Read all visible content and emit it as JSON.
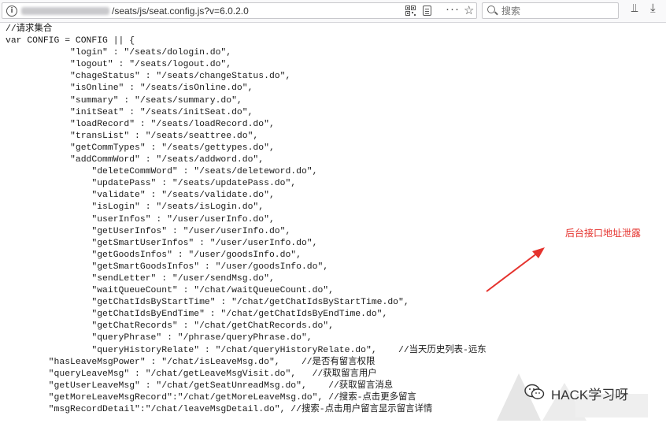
{
  "browser": {
    "url_path": "/seats/js/seat.config.js?v=6.0.2.0",
    "search_placeholder": "搜索",
    "more_glyph": "···"
  },
  "code_lines": [
    "//请求集合",
    "var CONFIG = CONFIG || {",
    "            \"login\" : \"/seats/dologin.do\",",
    "            \"logout\" : \"/seats/logout.do\",",
    "            \"chageStatus\" : \"/seats/changeStatus.do\",",
    "            \"isOnline\" : \"/seats/isOnline.do\",",
    "            \"summary\" : \"/seats/summary.do\",",
    "            \"initSeat\" : \"/seats/initSeat.do\",",
    "            \"loadRecord\" : \"/seats/loadRecord.do\",",
    "            \"transList\" : \"/seats/seattree.do\",",
    "            \"getCommTypes\" : \"/seats/gettypes.do\",",
    "            \"addCommWord\" : \"/seats/addword.do\",",
    "                \"deleteCommWord\" : \"/seats/deleteword.do\",",
    "                \"updatePass\" : \"/seats/updatePass.do\",",
    "                \"validate\" : \"/seats/validate.do\",",
    "                \"isLogin\" : \"/seats/isLogin.do\",",
    "                \"userInfos\" : \"/user/userInfo.do\",",
    "                \"getUserInfos\" : \"/user/userInfo.do\",",
    "                \"getSmartUserInfos\" : \"/user/userInfo.do\",",
    "                \"getGoodsInfos\" : \"/user/goodsInfo.do\",",
    "                \"getSmartGoodsInfos\" : \"/user/goodsInfo.do\",",
    "                \"sendLetter\" : \"/user/sendMsg.do\",",
    "                \"waitQueueCount\" : \"/chat/waitQueueCount.do\",",
    "                \"getChatIdsByStartTime\" : \"/chat/getChatIdsByStartTime.do\",",
    "                \"getChatIdsByEndTime\" : \"/chat/getChatIdsByEndTime.do\",",
    "                \"getChatRecords\" : \"/chat/getChatRecords.do\",",
    "                \"queryPhrase\" : \"/phrase/queryPhrase.do\",",
    "                \"queryHistoryRelate\" : \"/chat/queryHistoryRelate.do\",    //当天历史列表-远东",
    "        \"hasLeaveMsgPower\" : \"/chat/isLeaveMsg.do\",    //是否有留言权限",
    "        \"queryLeaveMsg\" : \"/chat/getLeaveMsgVisit.do\",   //获取留言用户",
    "        \"getUserLeaveMsg\" : \"/chat/getSeatUnreadMsg.do\",    //获取留言消息",
    "        \"getMoreLeaveMsgRecord\":\"/chat/getMoreLeaveMsg.do\", //搜索-点击更多留言",
    "        \"msgRecordDetail\":\"/chat/leaveMsgDetail.do\", //搜索-点击用户留言显示留言详情"
  ],
  "annotation": {
    "text": "后台接口地址泄露",
    "color": "#e5322d"
  },
  "watermark": {
    "text": "HACK学习呀"
  }
}
